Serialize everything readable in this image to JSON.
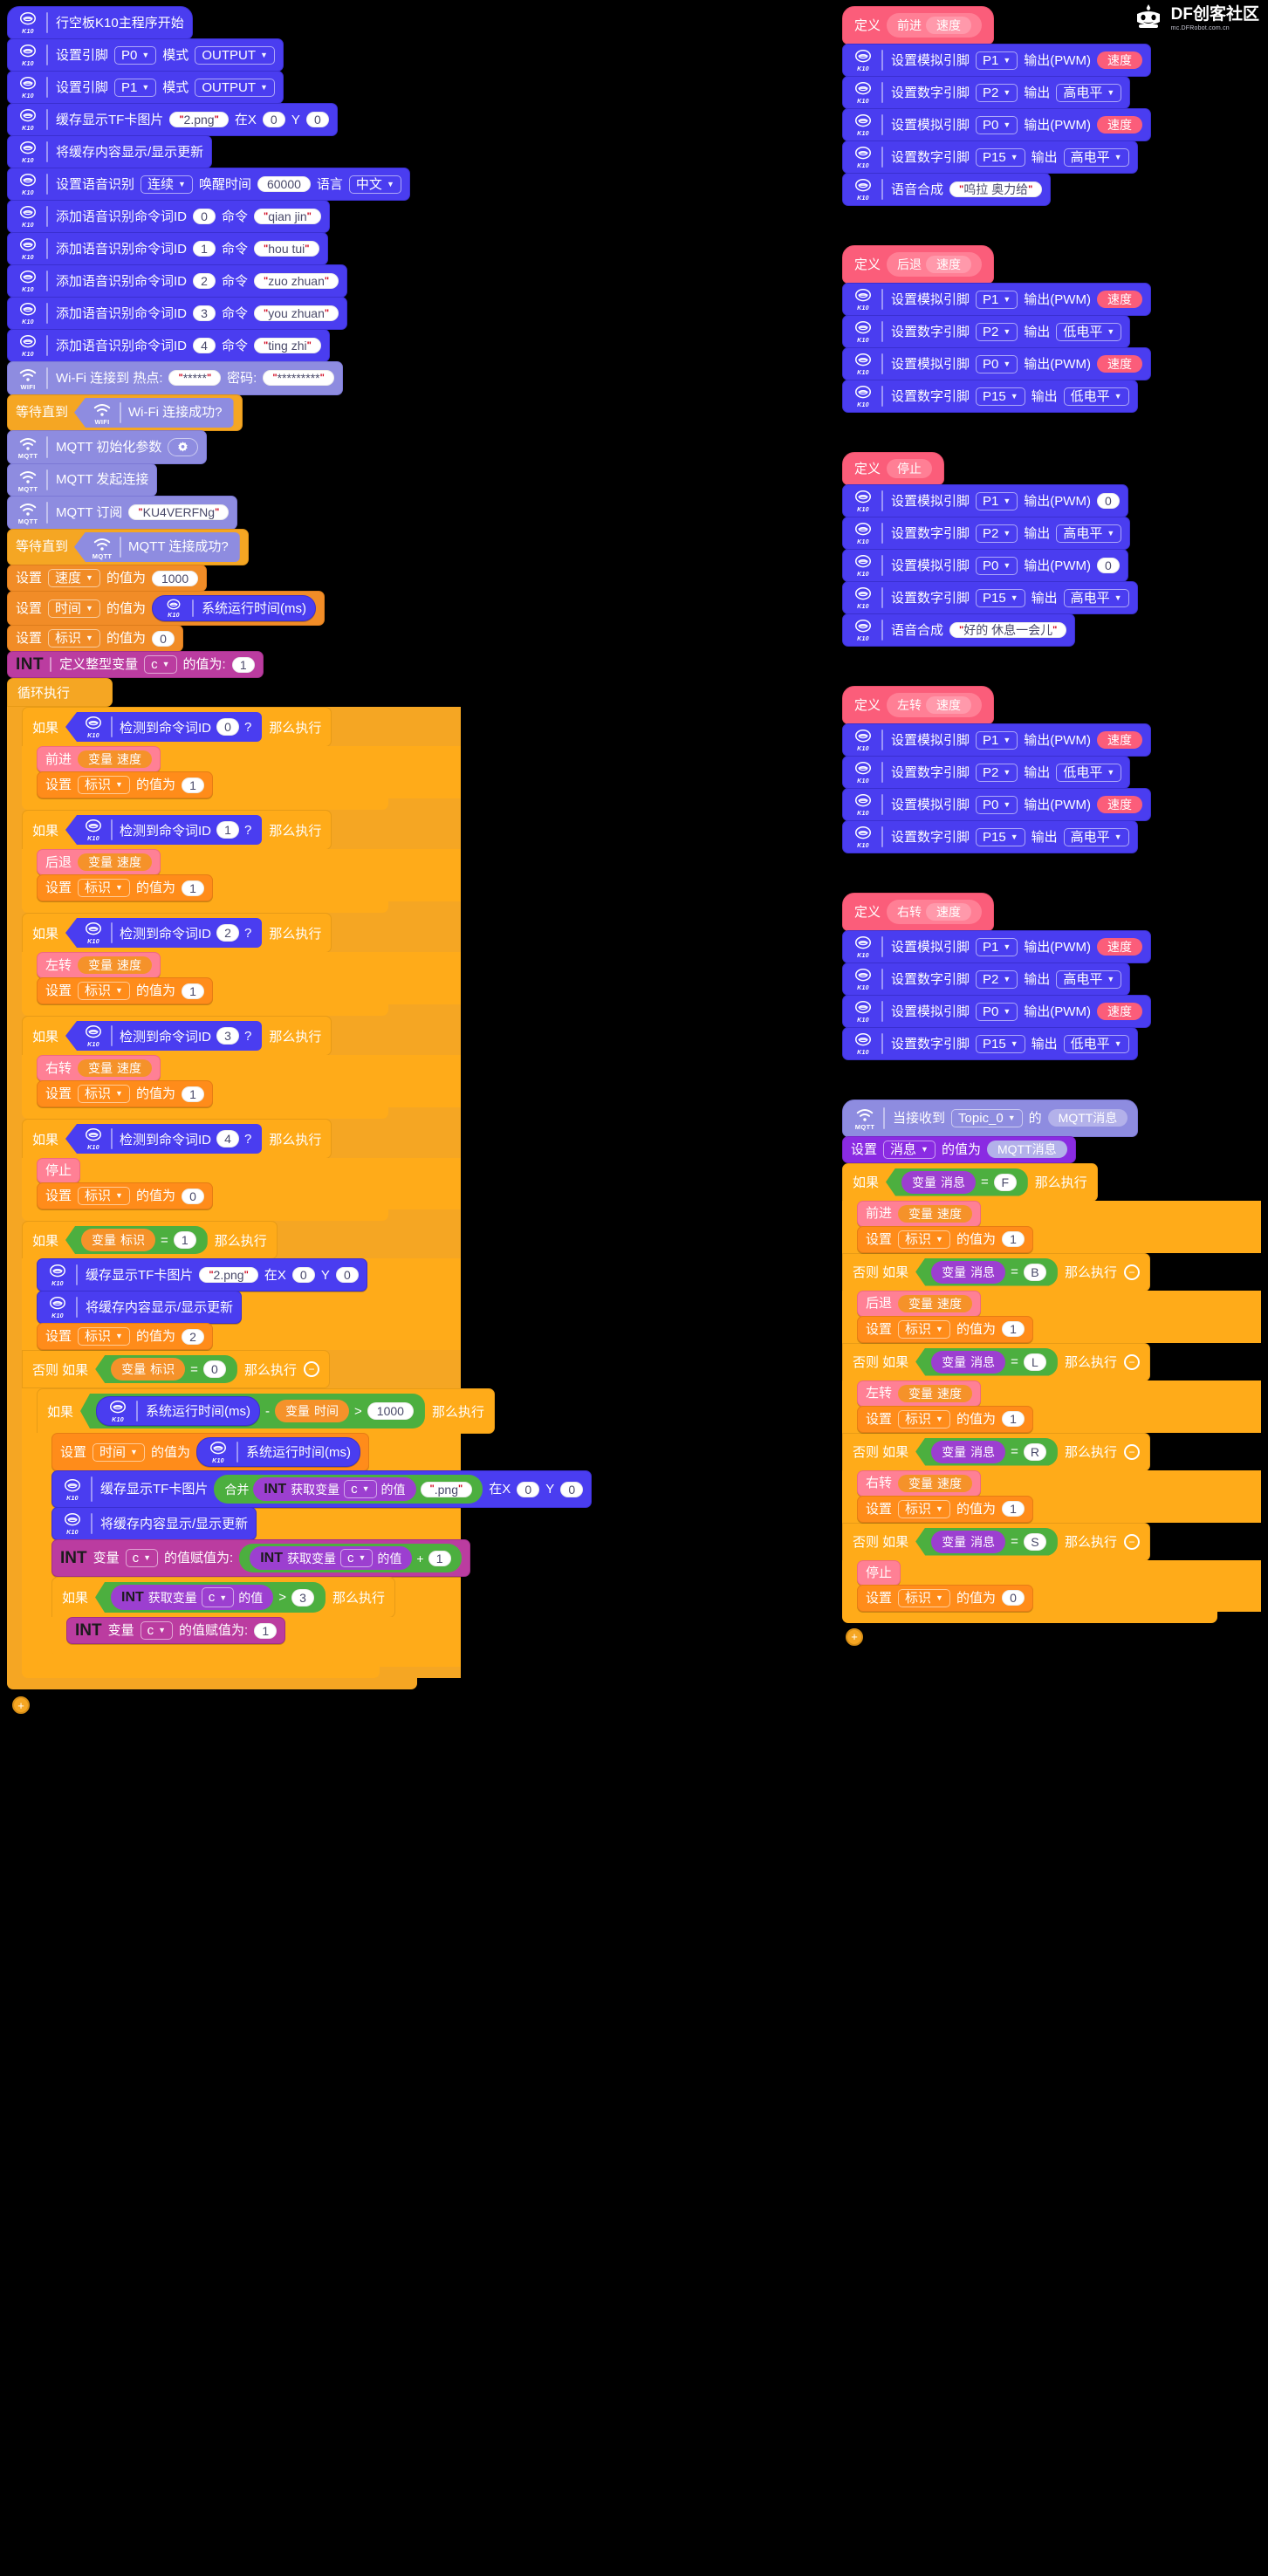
{
  "brand": {
    "name": "DF创客社区",
    "url": "mc.DFRobot.com.cn",
    "logo_icon": "df-robot-icon"
  },
  "icons": {
    "k10": "k10-board-icon",
    "wifi": "wifi-icon",
    "mqtt": "mqtt-icon",
    "gear": "gear-icon",
    "caret": "chevron-down-icon",
    "minus": "collapse-minus-icon",
    "plus": "add-block-plus-icon"
  },
  "icon_labels": {
    "k10": "K10",
    "wifi": "WIFI",
    "mqtt": "MQTT"
  },
  "colors": {
    "k10_blue": "#4a3df0",
    "wifi_lavender": "#8e8ce0",
    "control_orange": "#f5a623",
    "variable_orange": "#f18c27",
    "int_magenta": "#bb3ca0",
    "define_pink": "#fb5d7a",
    "operator_green": "#4caf3f",
    "purple": "#8a2be2",
    "background": "#000000"
  },
  "main_program": {
    "hat": "行空板K10主程序开始",
    "setup": [
      {
        "label": "设置引脚",
        "pin": "P0",
        "mode_label": "模式",
        "mode": "OUTPUT"
      },
      {
        "label": "设置引脚",
        "pin": "P1",
        "mode_label": "模式",
        "mode": "OUTPUT"
      }
    ],
    "tf_image": {
      "label": "缓存显示TF卡图片",
      "file": "2.png",
      "at_x_label": "在X",
      "x": "0",
      "y_label": "Y",
      "y": "0"
    },
    "refresh": "将缓存内容显示/显示更新",
    "voice_setup": {
      "label": "设置语音识别",
      "mode": "连续",
      "wake_label": "唤醒时间",
      "wake_time": "60000",
      "lang_label": "语言",
      "lang": "中文"
    },
    "voice_commands": [
      {
        "label": "添加语音识别命令词ID",
        "id": "0",
        "cmd_label": "命令",
        "word": "qian jin"
      },
      {
        "label": "添加语音识别命令词ID",
        "id": "1",
        "cmd_label": "命令",
        "word": "hou tui"
      },
      {
        "label": "添加语音识别命令词ID",
        "id": "2",
        "cmd_label": "命令",
        "word": "zuo zhuan"
      },
      {
        "label": "添加语音识别命令词ID",
        "id": "3",
        "cmd_label": "命令",
        "word": "you zhuan"
      },
      {
        "label": "添加语音识别命令词ID",
        "id": "4",
        "cmd_label": "命令",
        "word": "ting zhi"
      }
    ],
    "wifi": {
      "connect_label": "Wi-Fi 连接到 热点:",
      "ssid": "*****",
      "password_label": "密码:",
      "password": "*********",
      "wait_label": "等待直到",
      "wait_cond": "Wi-Fi 连接成功?"
    },
    "mqtt": {
      "init": "MQTT 初始化参数",
      "connect": "MQTT 发起连接",
      "subscribe_label": "MQTT 订阅",
      "topic": "KU4VERFNg",
      "wait_label": "等待直到",
      "wait_cond": "MQTT 连接成功?"
    },
    "var_init": [
      {
        "set_label": "设置",
        "var": "速度",
        "of_label": "的值为",
        "value": "1000",
        "value_type": "number"
      },
      {
        "set_label": "设置",
        "var": "时间",
        "of_label": "的值为",
        "value": "系统运行时间(ms)",
        "value_type": "k10-reporter"
      },
      {
        "set_label": "设置",
        "var": "标识",
        "of_label": "的值为",
        "value": "0",
        "value_type": "number"
      }
    ],
    "int_define": {
      "badge": "INT",
      "label": "定义整型变量",
      "var": "c",
      "of_label": "的值为:",
      "value": "1"
    },
    "forever_label": "循环执行"
  },
  "loop_branches": [
    {
      "if_label": "如果",
      "cond_label": "检测到命令词ID",
      "cond_id": "0",
      "q": "?",
      "then_label": "那么执行",
      "action": "前进",
      "action_arg_prefix": "变量",
      "action_arg": "速度",
      "set_label": "设置",
      "set_var": "标识",
      "set_of": "的值为",
      "set_val": "1"
    },
    {
      "if_label": "如果",
      "cond_label": "检测到命令词ID",
      "cond_id": "1",
      "q": "?",
      "then_label": "那么执行",
      "action": "后退",
      "action_arg_prefix": "变量",
      "action_arg": "速度",
      "set_label": "设置",
      "set_var": "标识",
      "set_of": "的值为",
      "set_val": "1"
    },
    {
      "if_label": "如果",
      "cond_label": "检测到命令词ID",
      "cond_id": "2",
      "q": "?",
      "then_label": "那么执行",
      "action": "左转",
      "action_arg_prefix": "变量",
      "action_arg": "速度",
      "set_label": "设置",
      "set_var": "标识",
      "set_of": "的值为",
      "set_val": "1"
    },
    {
      "if_label": "如果",
      "cond_label": "检测到命令词ID",
      "cond_id": "3",
      "q": "?",
      "then_label": "那么执行",
      "action": "右转",
      "action_arg_prefix": "变量",
      "action_arg": "速度",
      "set_label": "设置",
      "set_var": "标识",
      "set_of": "的值为",
      "set_val": "1"
    },
    {
      "if_label": "如果",
      "cond_label": "检测到命令词ID",
      "cond_id": "4",
      "q": "?",
      "then_label": "那么执行",
      "action": "停止",
      "action_arg_prefix": "",
      "action_arg": "",
      "set_label": "设置",
      "set_var": "标识",
      "set_of": "的值为",
      "set_val": "0"
    }
  ],
  "flag_branch": {
    "if_label": "如果",
    "var_prefix": "变量",
    "var": "标识",
    "op": "=",
    "value": "1",
    "then_label": "那么执行",
    "tf_image": {
      "label": "缓存显示TF卡图片",
      "file": "2.png",
      "at_x_label": "在X",
      "x": "0",
      "y_label": "Y",
      "y": "0"
    },
    "refresh": "将缓存内容显示/显示更新",
    "set_label": "设置",
    "set_var": "标识",
    "set_of": "的值为",
    "set_val": "2",
    "else_label": "否则 如果",
    "else_var_prefix": "变量",
    "else_var": "标识",
    "else_op": "=",
    "else_value": "0",
    "else_then": "那么执行"
  },
  "timer_branch": {
    "if_label": "如果",
    "uptime": "系统运行时间(ms)",
    "minus": "-",
    "var_prefix": "变量",
    "var": "时间",
    "gt": ">",
    "threshold": "1000",
    "then_label": "那么执行",
    "set_time": {
      "set_label": "设置",
      "var": "时间",
      "of_label": "的值为",
      "value": "系统运行时间(ms)"
    },
    "tf_image": {
      "label": "缓存显示TF卡图片",
      "join_label": "合并",
      "badge": "INT",
      "get_label": "获取变量",
      "var": "c",
      "of_label": "的值",
      "suffix": ".png",
      "at_x_label": "在X",
      "x": "0",
      "y_label": "Y",
      "y": "0"
    },
    "refresh": "将缓存内容显示/显示更新",
    "assign": {
      "badge": "INT",
      "label": "变量",
      "var": "c",
      "assign_label": "的值赋值为:",
      "badge2": "INT",
      "get_label": "获取变量",
      "var2": "c",
      "of_label": "的值",
      "plus": "+",
      "addend": "1"
    },
    "inner_if": {
      "if_label": "如果",
      "badge": "INT",
      "get_label": "获取变量",
      "var": "c",
      "of_label": "的值",
      "gt": ">",
      "value": "3",
      "then_label": "那么执行",
      "assign": {
        "badge": "INT",
        "label": "变量",
        "var": "c",
        "assign_label": "的值赋值为:",
        "value": "1"
      }
    }
  },
  "definitions": [
    {
      "def_label": "定义",
      "name": "前进",
      "param": "速度",
      "body": [
        {
          "type": "analog",
          "label": "设置模拟引脚",
          "pin": "P1",
          "out_label": "输出(PWM)",
          "value": "速度",
          "value_type": "param"
        },
        {
          "type": "digital",
          "label": "设置数字引脚",
          "pin": "P2",
          "out_label": "输出",
          "value": "高电平",
          "value_type": "dropdown"
        },
        {
          "type": "analog",
          "label": "设置模拟引脚",
          "pin": "P0",
          "out_label": "输出(PWM)",
          "value": "速度",
          "value_type": "param"
        },
        {
          "type": "digital",
          "label": "设置数字引脚",
          "pin": "P15",
          "out_label": "输出",
          "value": "高电平",
          "value_type": "dropdown"
        },
        {
          "type": "speech",
          "label": "语音合成",
          "text": "呜拉 奥力给"
        }
      ]
    },
    {
      "def_label": "定义",
      "name": "后退",
      "param": "速度",
      "body": [
        {
          "type": "analog",
          "label": "设置模拟引脚",
          "pin": "P1",
          "out_label": "输出(PWM)",
          "value": "速度",
          "value_type": "param"
        },
        {
          "type": "digital",
          "label": "设置数字引脚",
          "pin": "P2",
          "out_label": "输出",
          "value": "低电平",
          "value_type": "dropdown"
        },
        {
          "type": "analog",
          "label": "设置模拟引脚",
          "pin": "P0",
          "out_label": "输出(PWM)",
          "value": "速度",
          "value_type": "param"
        },
        {
          "type": "digital",
          "label": "设置数字引脚",
          "pin": "P15",
          "out_label": "输出",
          "value": "低电平",
          "value_type": "dropdown"
        }
      ]
    },
    {
      "def_label": "定义",
      "name": "停止",
      "param": "",
      "body": [
        {
          "type": "analog",
          "label": "设置模拟引脚",
          "pin": "P1",
          "out_label": "输出(PWM)",
          "value": "0",
          "value_type": "number"
        },
        {
          "type": "digital",
          "label": "设置数字引脚",
          "pin": "P2",
          "out_label": "输出",
          "value": "高电平",
          "value_type": "dropdown"
        },
        {
          "type": "analog",
          "label": "设置模拟引脚",
          "pin": "P0",
          "out_label": "输出(PWM)",
          "value": "0",
          "value_type": "number"
        },
        {
          "type": "digital",
          "label": "设置数字引脚",
          "pin": "P15",
          "out_label": "输出",
          "value": "高电平",
          "value_type": "dropdown"
        },
        {
          "type": "speech",
          "label": "语音合成",
          "text": "好的 休息一会儿"
        }
      ]
    },
    {
      "def_label": "定义",
      "name": "左转",
      "param": "速度",
      "body": [
        {
          "type": "analog",
          "label": "设置模拟引脚",
          "pin": "P1",
          "out_label": "输出(PWM)",
          "value": "速度",
          "value_type": "param"
        },
        {
          "type": "digital",
          "label": "设置数字引脚",
          "pin": "P2",
          "out_label": "输出",
          "value": "低电平",
          "value_type": "dropdown"
        },
        {
          "type": "analog",
          "label": "设置模拟引脚",
          "pin": "P0",
          "out_label": "输出(PWM)",
          "value": "速度",
          "value_type": "param"
        },
        {
          "type": "digital",
          "label": "设置数字引脚",
          "pin": "P15",
          "out_label": "输出",
          "value": "高电平",
          "value_type": "dropdown"
        }
      ]
    },
    {
      "def_label": "定义",
      "name": "右转",
      "param": "速度",
      "body": [
        {
          "type": "analog",
          "label": "设置模拟引脚",
          "pin": "P1",
          "out_label": "输出(PWM)",
          "value": "速度",
          "value_type": "param"
        },
        {
          "type": "digital",
          "label": "设置数字引脚",
          "pin": "P2",
          "out_label": "输出",
          "value": "高电平",
          "value_type": "dropdown"
        },
        {
          "type": "analog",
          "label": "设置模拟引脚",
          "pin": "P0",
          "out_label": "输出(PWM)",
          "value": "速度",
          "value_type": "param"
        },
        {
          "type": "digital",
          "label": "设置数字引脚",
          "pin": "P15",
          "out_label": "输出",
          "value": "低电平",
          "value_type": "dropdown"
        }
      ]
    }
  ],
  "mqtt_handler": {
    "hat_prefix": "当接收到",
    "topic": "Topic_0",
    "hat_mid": "的",
    "hat_msg": "MQTT消息",
    "set_label": "设置",
    "set_var": "消息",
    "set_of": "的值为",
    "set_value": "MQTT消息",
    "branches": [
      {
        "if_label": "如果",
        "var_prefix": "变量",
        "var": "消息",
        "op": "=",
        "value": "F",
        "then_label": "那么执行",
        "action": "前进",
        "arg_prefix": "变量",
        "arg": "速度",
        "set_label": "设置",
        "set_var": "标识",
        "set_of": "的值为",
        "set_val": "1",
        "has_minus": false
      },
      {
        "if_label": "否则 如果",
        "var_prefix": "变量",
        "var": "消息",
        "op": "=",
        "value": "B",
        "then_label": "那么执行",
        "action": "后退",
        "arg_prefix": "变量",
        "arg": "速度",
        "set_label": "设置",
        "set_var": "标识",
        "set_of": "的值为",
        "set_val": "1",
        "has_minus": true
      },
      {
        "if_label": "否则 如果",
        "var_prefix": "变量",
        "var": "消息",
        "op": "=",
        "value": "L",
        "then_label": "那么执行",
        "action": "左转",
        "arg_prefix": "变量",
        "arg": "速度",
        "set_label": "设置",
        "set_var": "标识",
        "set_of": "的值为",
        "set_val": "1",
        "has_minus": true
      },
      {
        "if_label": "否则 如果",
        "var_prefix": "变量",
        "var": "消息",
        "op": "=",
        "value": "R",
        "then_label": "那么执行",
        "action": "右转",
        "arg_prefix": "变量",
        "arg": "速度",
        "set_label": "设置",
        "set_var": "标识",
        "set_of": "的值为",
        "set_val": "1",
        "has_minus": true
      },
      {
        "if_label": "否则 如果",
        "var_prefix": "变量",
        "var": "消息",
        "op": "=",
        "value": "S",
        "then_label": "那么执行",
        "action": "停止",
        "arg_prefix": "",
        "arg": "",
        "set_label": "设置",
        "set_var": "标识",
        "set_of": "的值为",
        "set_val": "0",
        "has_minus": true
      }
    ]
  }
}
